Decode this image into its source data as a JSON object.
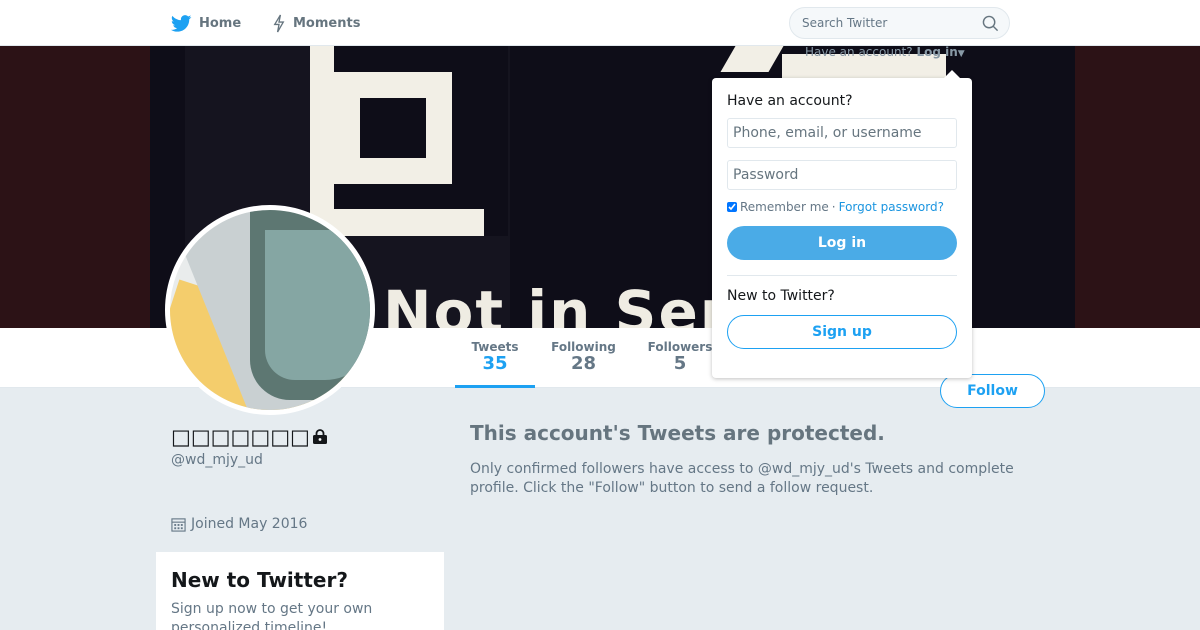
{
  "nav": {
    "home_label": "Home",
    "moments_label": "Moments",
    "search_placeholder": "Search Twitter",
    "icons": {
      "home": "twitter-bird-icon",
      "moments": "lightning-icon",
      "search": "search-icon"
    }
  },
  "banner": {
    "sign_text": "Not in Ser",
    "login_hint_prefix": "Have an account?",
    "login_hint_link": "Log in"
  },
  "profile": {
    "display_name": "□□□□□□□",
    "handle": "@wd_mjy_ud",
    "joined": "Joined May 2016",
    "protected_icon": "lock-icon",
    "calendar_icon": "calendar-icon"
  },
  "stats": [
    {
      "label": "Tweets",
      "value": "35"
    },
    {
      "label": "Following",
      "value": "28"
    },
    {
      "label": "Followers",
      "value": "5"
    }
  ],
  "follow_label": "Follow",
  "protected": {
    "title": "This account's Tweets are protected.",
    "text": "Only confirmed followers have access to @wd_mjy_ud's Tweets and complete profile. Click the \"Follow\" button to send a follow request."
  },
  "signup_card": {
    "title": "New to Twitter?",
    "text": "Sign up now to get your own personalized timeline!"
  },
  "login_dropdown": {
    "heading": "Have an account?",
    "username_placeholder": "Phone, email, or username",
    "password_placeholder": "Password",
    "remember_label": "Remember me",
    "separator": "·",
    "forgot_label": "Forgot password?",
    "login_button": "Log in",
    "new_heading": "New to Twitter?",
    "signup_button": "Sign up"
  },
  "colors": {
    "accent": "#1da1f2",
    "login_button_bg": "#4aabe7",
    "page_bg": "#e6ecf0"
  }
}
